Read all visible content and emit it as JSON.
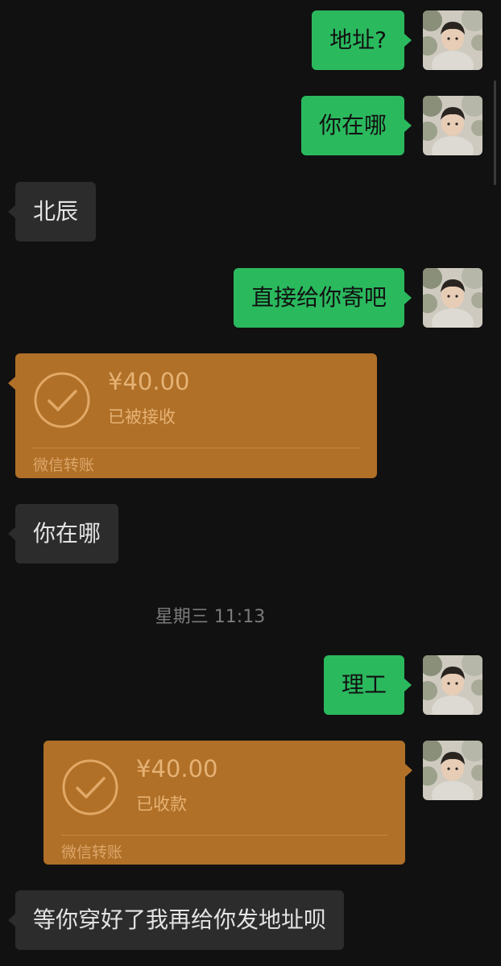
{
  "messages": {
    "m1": "地址?",
    "m2": "你在哪",
    "m3": "北辰",
    "m4": "直接给你寄吧",
    "m6": "你在哪",
    "m7": "理工",
    "m9": "等你穿好了我再给你发地址呗"
  },
  "transfer1": {
    "amount": "¥40.00",
    "status": "已被接收",
    "brand": "微信转账"
  },
  "transfer2": {
    "amount": "¥40.00",
    "status": "已收款",
    "brand": "微信转账"
  },
  "timestamp": "星期三 11:13",
  "colors": {
    "background": "#111111",
    "outgoing_bubble": "#2bb95e",
    "incoming_bubble": "#2c2c2c",
    "transfer_card": "#b07028"
  }
}
